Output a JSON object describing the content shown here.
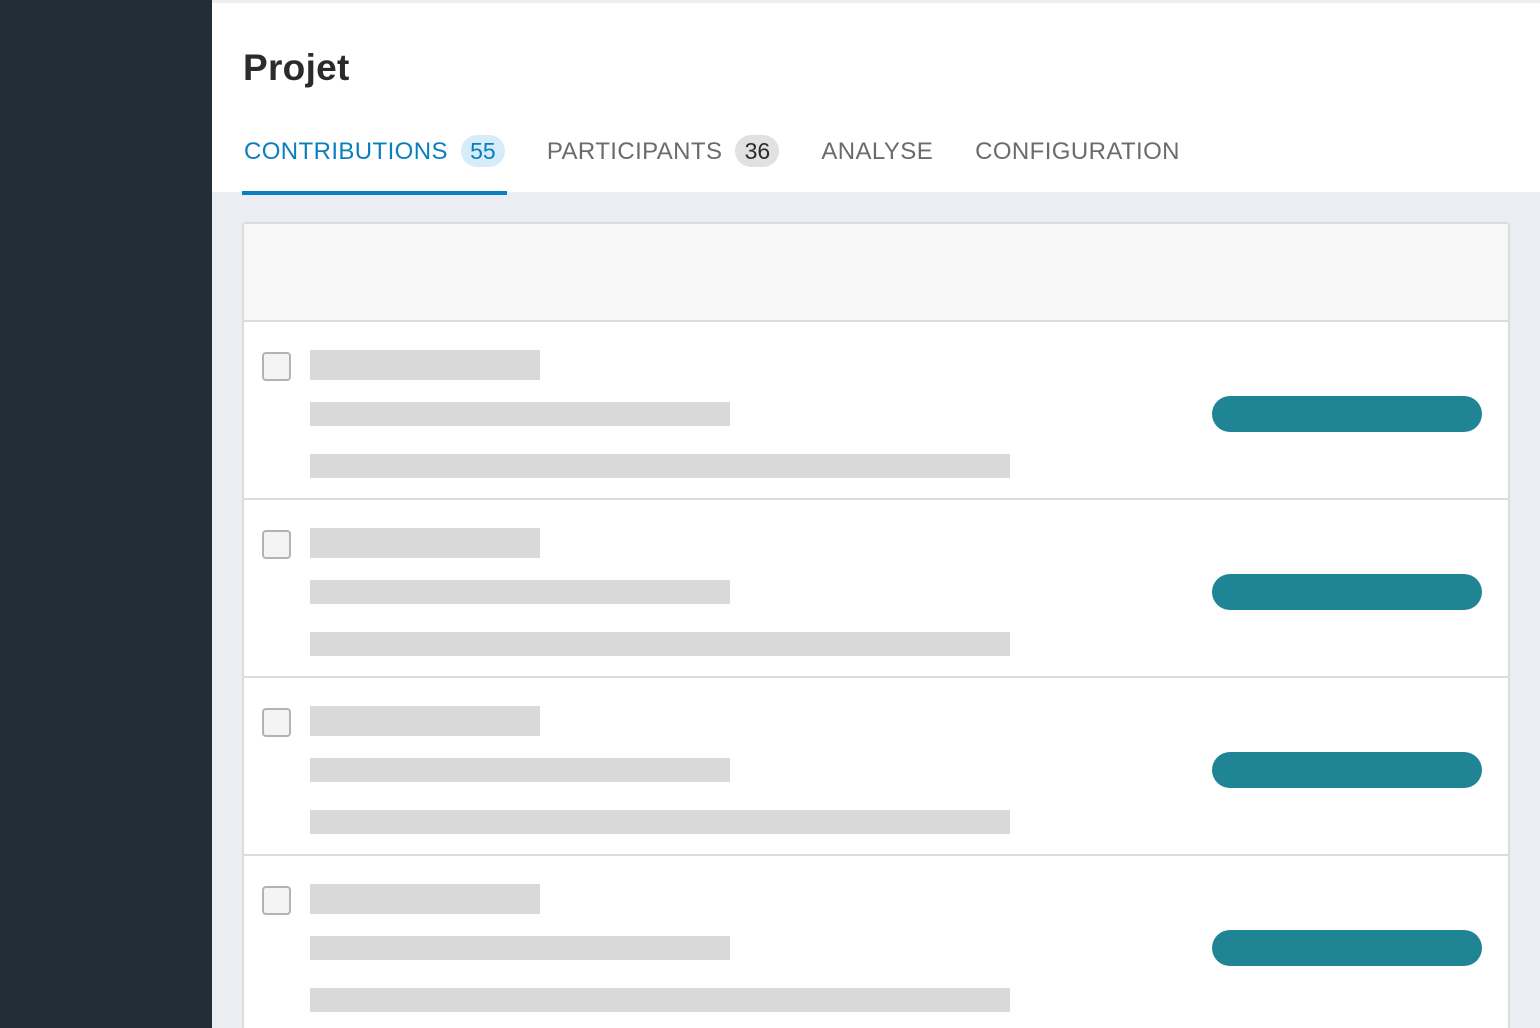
{
  "page": {
    "title": "Projet"
  },
  "tabs": [
    {
      "label": "CONTRIBUTIONS",
      "count": "55",
      "active": true
    },
    {
      "label": "PARTICIPANTS",
      "count": "36",
      "active": false
    },
    {
      "label": "ANALYSE",
      "active": false
    },
    {
      "label": "CONFIGURATION",
      "active": false
    }
  ],
  "list": {
    "state": "loading",
    "placeholder_rows": 4
  },
  "colors": {
    "sidebar": "#222e35",
    "accent": "#0a7fc0",
    "status_pill": "#1f8494",
    "skeleton": "#d9d9d9",
    "background": "#eaeef2"
  }
}
